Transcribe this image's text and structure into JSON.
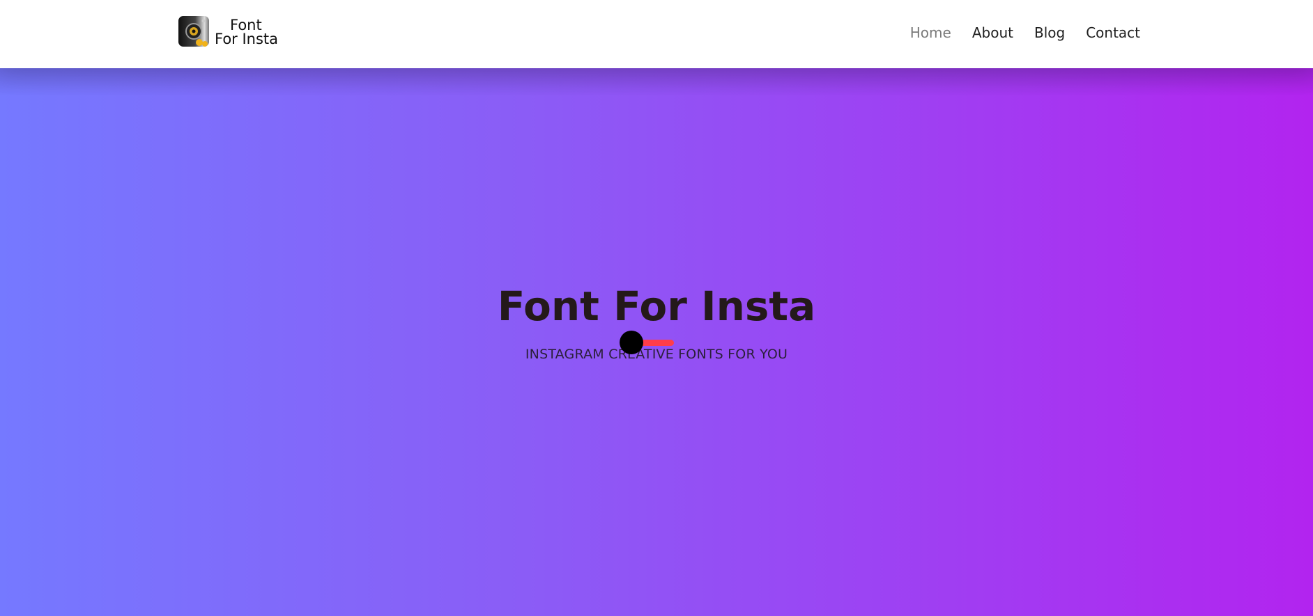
{
  "brand": {
    "logo_line1": "Font",
    "logo_line2": "For Insta",
    "icon": "camera-logo-icon"
  },
  "nav": {
    "items": [
      {
        "label": "Home",
        "active": true
      },
      {
        "label": "About",
        "active": false
      },
      {
        "label": "Blog",
        "active": false
      },
      {
        "label": "Contact",
        "active": false
      }
    ]
  },
  "hero": {
    "title": "Font For Insta",
    "subtitle": "INSTAGRAM CREATIVE FONTS FOR YOU",
    "toggle_state": "off"
  },
  "colors": {
    "gradient_start": "#7579ff",
    "gradient_end": "#b224ef",
    "toggle_track": "#ff3d4a",
    "toggle_knob": "#000000",
    "nav_active": "#7a7a7a"
  }
}
